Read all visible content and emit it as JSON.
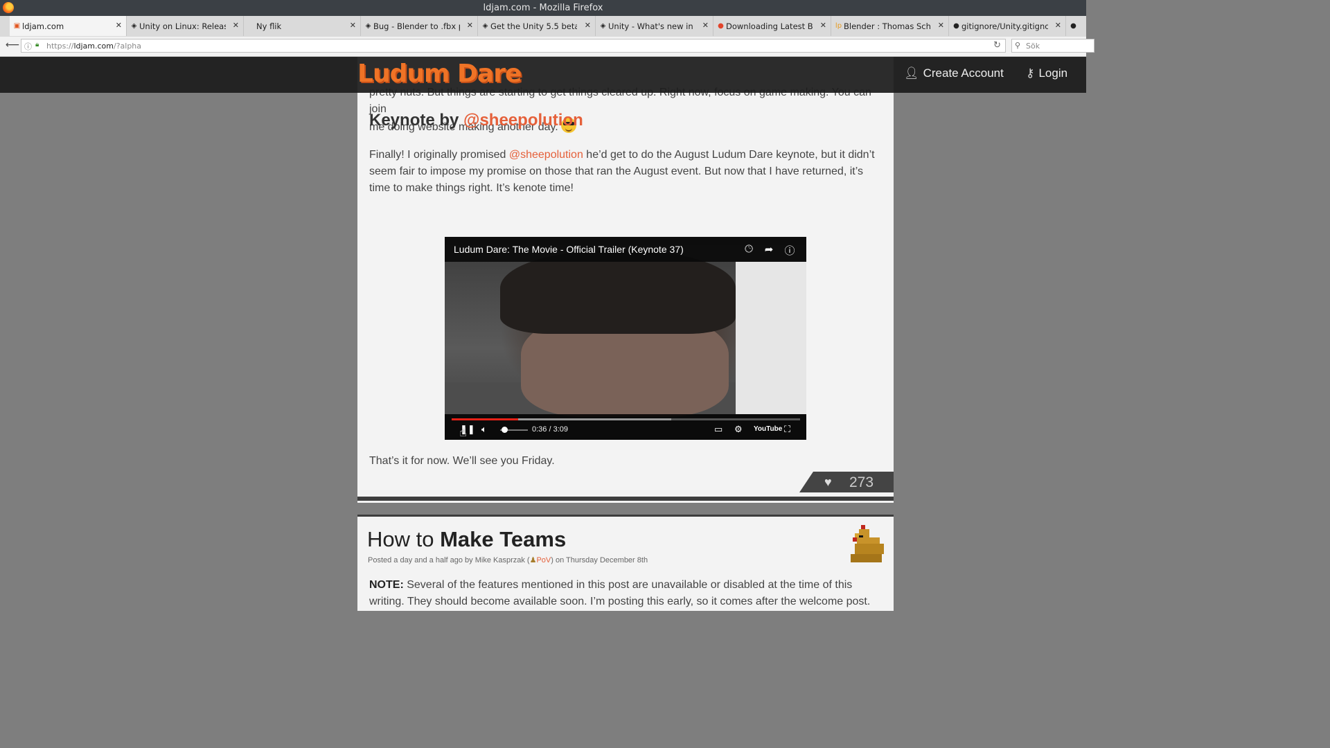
{
  "window": {
    "title": "ldjam.com - Mozilla Firefox"
  },
  "tabs": [
    {
      "label": "ldjam.com",
      "favicon": "ldjam-icon",
      "color": "#e25822",
      "glyph": "▣"
    },
    {
      "label": "Unity on Linux: Release...",
      "favicon": "unity-icon",
      "color": "#222222",
      "glyph": "◈"
    },
    {
      "label": "Ny flik",
      "favicon": "",
      "color": "",
      "glyph": ""
    },
    {
      "label": "Bug - Blender to .fbx pr...",
      "favicon": "unity-icon",
      "color": "#222222",
      "glyph": "◈"
    },
    {
      "label": "Get the Unity 5.5 beta ...",
      "favicon": "unity-icon",
      "color": "#222222",
      "glyph": "◈"
    },
    {
      "label": "Unity - What's new in U...",
      "favicon": "unity-icon",
      "color": "#222222",
      "glyph": "◈"
    },
    {
      "label": "Downloading Latest Bl...",
      "favicon": "ask-icon",
      "color": "#e2442b",
      "glyph": "●"
    },
    {
      "label": "Blender : Thomas Schiex",
      "favicon": "launchpad-icon",
      "color": "#e89b21",
      "glyph": "lp"
    },
    {
      "label": "gitignore/Unity.gitigno...",
      "favicon": "github-icon",
      "color": "#222222",
      "glyph": "●"
    },
    {
      "label": "",
      "favicon": "github-icon",
      "color": "#222222",
      "glyph": "●"
    }
  ],
  "navbar": {
    "url_scheme": "https://",
    "url_host": "ldjam.com",
    "url_path": "/?alpha",
    "search_placeholder": "Sök"
  },
  "header": {
    "logo_text": "Ludum Dare",
    "create_account": "Create Account",
    "login": "Login",
    "accent": "#ef7326"
  },
  "post1": {
    "para_top_1": "pretty nuts. But things are starting to get things cleared up. Right now, focus on game making. You can join",
    "para_top_2": "me doing website making another day.",
    "heading_prefix": "Keynote by",
    "heading_link": "@sheepolution",
    "para_mid_1": "Finally! I originally promised",
    "para_mid_link": "@sheepolution",
    "para_mid_2": "he’d get to do the August Ludum Dare keynote, but it didn’t seem fair to impose my promise on those that ran the August event. But now that I have returned, it’s time to make things right. It’s kenote time!",
    "closing": "That’s it for now. We’ll see you Friday.",
    "likes": "273"
  },
  "video": {
    "title": "Ludum Dare: The Movie - Official Trailer (Keynote 37)",
    "time": "0:36 / 3:09",
    "played_fraction": 0.19,
    "buffered_fraction": 0.63,
    "volume_fraction": 0.1,
    "youtube_label": "YouTube"
  },
  "post2": {
    "title_prefix": "How to",
    "title_bold": "Make Teams",
    "meta_prefix": "Posted a day and a half ago by Mike Kasprzak (",
    "meta_link": "PoV",
    "meta_suffix": ") on Thursday December 8th",
    "note_label": "NOTE:",
    "note_text": "Several of the features mentioned in this post are unavailable or disabled at the time of this writing. They should become available soon. I’m posting this early, so it comes after the welcome post."
  }
}
